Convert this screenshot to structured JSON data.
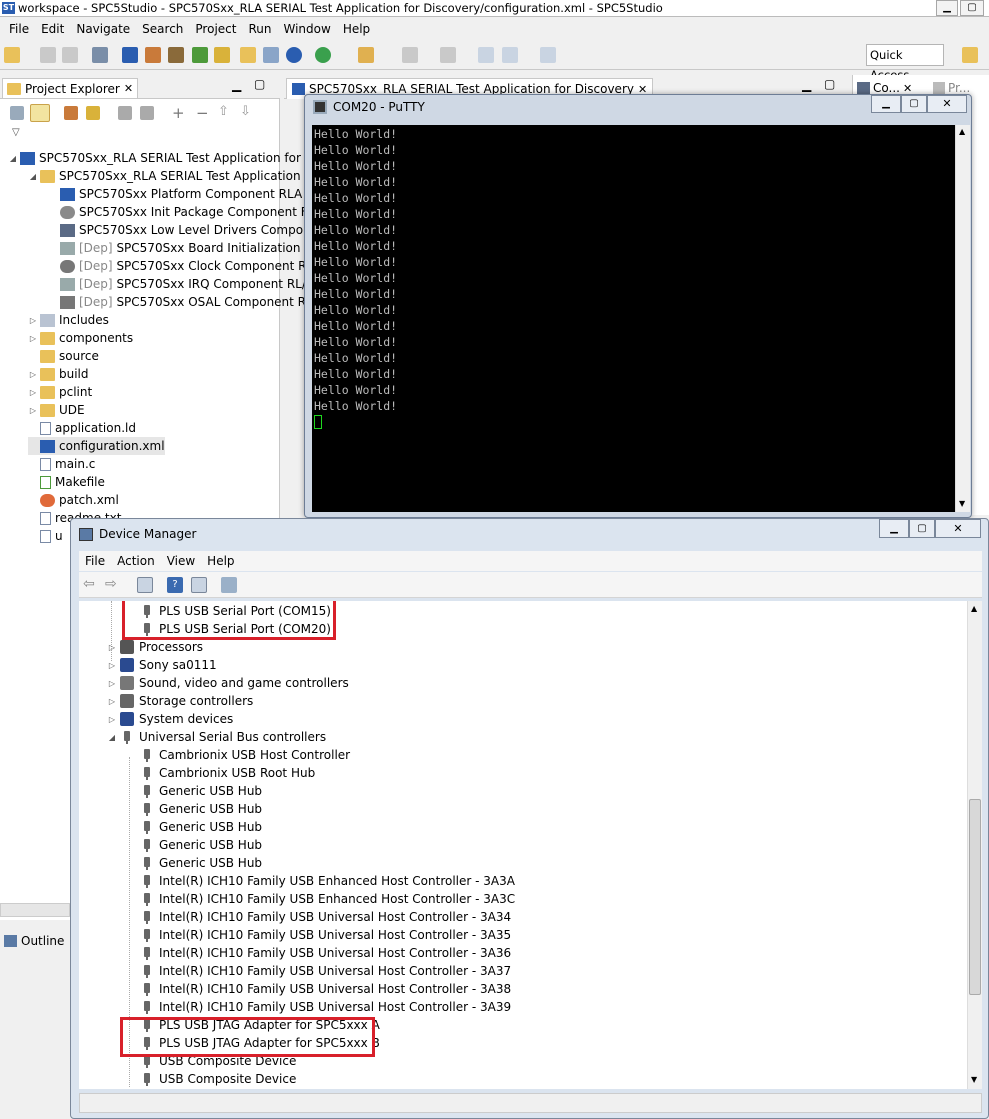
{
  "app": {
    "title": "workspace - SPC5Studio - SPC570Sxx_RLA SERIAL Test Application for Discovery/configuration.xml - SPC5Studio",
    "menu": [
      "File",
      "Edit",
      "Navigate",
      "Search",
      "Project",
      "Run",
      "Window",
      "Help"
    ],
    "quick_access": "Quick Access"
  },
  "project_explorer": {
    "tab": "Project Explorer",
    "items": [
      {
        "label": "SPC570Sxx_RLA SERIAL Test Application for D",
        "prefix": ""
      },
      {
        "label": "SPC570Sxx_RLA SERIAL Test Application f",
        "prefix": ""
      },
      {
        "label": "SPC570Sxx Platform Component RLA",
        "prefix": ""
      },
      {
        "label": "SPC570Sxx Init Package Component F",
        "prefix": ""
      },
      {
        "label": "SPC570Sxx Low Level Drivers Compor",
        "prefix": ""
      },
      {
        "label": "SPC570Sxx Board Initialization C",
        "prefix": "[Dep]"
      },
      {
        "label": "SPC570Sxx Clock Component R",
        "prefix": "[Dep]"
      },
      {
        "label": "SPC570Sxx IRQ Component RL/",
        "prefix": "[Dep]"
      },
      {
        "label": "SPC570Sxx OSAL Component R",
        "prefix": "[Dep]"
      },
      {
        "label": "Includes",
        "prefix": ""
      },
      {
        "label": "components",
        "prefix": ""
      },
      {
        "label": "source",
        "prefix": ""
      },
      {
        "label": "build",
        "prefix": ""
      },
      {
        "label": "pclint",
        "prefix": ""
      },
      {
        "label": "UDE",
        "prefix": ""
      },
      {
        "label": "application.ld",
        "prefix": ""
      },
      {
        "label": "configuration.xml",
        "prefix": ""
      },
      {
        "label": "main.c",
        "prefix": ""
      },
      {
        "label": "Makefile",
        "prefix": ""
      },
      {
        "label": "patch.xml",
        "prefix": ""
      },
      {
        "label": "readme.txt",
        "prefix": ""
      },
      {
        "label": "u",
        "prefix": ""
      }
    ],
    "outline_tab": "Outline"
  },
  "editor": {
    "tab": "SPC570Sxx_RLA SERIAL Test Application for Discovery",
    "right_tab": "Co...",
    "right_tab2": "Pr..."
  },
  "putty": {
    "title": "COM20 - PuTTY",
    "lines": [
      "Hello World!",
      "Hello World!",
      "Hello World!",
      "Hello World!",
      "Hello World!",
      "Hello World!",
      "Hello World!",
      "Hello World!",
      "Hello World!",
      "Hello World!",
      "Hello World!",
      "Hello World!",
      "Hello World!",
      "Hello World!",
      "Hello World!",
      "Hello World!",
      "Hello World!",
      "Hello World!"
    ]
  },
  "device_manager": {
    "title": "Device Manager",
    "menu": [
      "File",
      "Action",
      "View",
      "Help"
    ],
    "rows": [
      {
        "label": "PLS USB Serial Port (COM15)",
        "level": 2,
        "kind": "port"
      },
      {
        "label": "PLS USB Serial Port (COM20)",
        "level": 2,
        "kind": "port"
      },
      {
        "label": "Processors",
        "level": 1,
        "kind": "cat"
      },
      {
        "label": "Sony sa0111",
        "level": 1,
        "kind": "cat"
      },
      {
        "label": "Sound, video and game controllers",
        "level": 1,
        "kind": "cat"
      },
      {
        "label": "Storage controllers",
        "level": 1,
        "kind": "cat"
      },
      {
        "label": "System devices",
        "level": 1,
        "kind": "cat"
      },
      {
        "label": "Universal Serial Bus controllers",
        "level": 1,
        "kind": "open"
      },
      {
        "label": "Cambrionix USB Host Controller",
        "level": 2,
        "kind": "usb"
      },
      {
        "label": "Cambrionix USB Root Hub",
        "level": 2,
        "kind": "usb"
      },
      {
        "label": "Generic USB Hub",
        "level": 2,
        "kind": "usb"
      },
      {
        "label": "Generic USB Hub",
        "level": 2,
        "kind": "usb"
      },
      {
        "label": "Generic USB Hub",
        "level": 2,
        "kind": "usb"
      },
      {
        "label": "Generic USB Hub",
        "level": 2,
        "kind": "usb"
      },
      {
        "label": "Generic USB Hub",
        "level": 2,
        "kind": "usb"
      },
      {
        "label": "Intel(R) ICH10 Family USB Enhanced Host Controller - 3A3A",
        "level": 2,
        "kind": "usb"
      },
      {
        "label": "Intel(R) ICH10 Family USB Enhanced Host Controller - 3A3C",
        "level": 2,
        "kind": "usb"
      },
      {
        "label": "Intel(R) ICH10 Family USB Universal Host Controller - 3A34",
        "level": 2,
        "kind": "usb"
      },
      {
        "label": "Intel(R) ICH10 Family USB Universal Host Controller - 3A35",
        "level": 2,
        "kind": "usb"
      },
      {
        "label": "Intel(R) ICH10 Family USB Universal Host Controller - 3A36",
        "level": 2,
        "kind": "usb"
      },
      {
        "label": "Intel(R) ICH10 Family USB Universal Host Controller - 3A37",
        "level": 2,
        "kind": "usb"
      },
      {
        "label": "Intel(R) ICH10 Family USB Universal Host Controller - 3A38",
        "level": 2,
        "kind": "usb"
      },
      {
        "label": "Intel(R) ICH10 Family USB Universal Host Controller - 3A39",
        "level": 2,
        "kind": "usb"
      },
      {
        "label": "PLS USB JTAG Adapter for SPC5xxx A",
        "level": 2,
        "kind": "usb"
      },
      {
        "label": "PLS USB JTAG Adapter for SPC5xxx B",
        "level": 2,
        "kind": "usb"
      },
      {
        "label": "USB Composite Device",
        "level": 2,
        "kind": "usb"
      },
      {
        "label": "USB Composite Device",
        "level": 2,
        "kind": "usb"
      }
    ]
  },
  "colors": {
    "highlight": "#d8202a",
    "terminal_bg": "#000000",
    "terminal_fg": "#bbbbbb",
    "cursor": "#1fd81f"
  }
}
